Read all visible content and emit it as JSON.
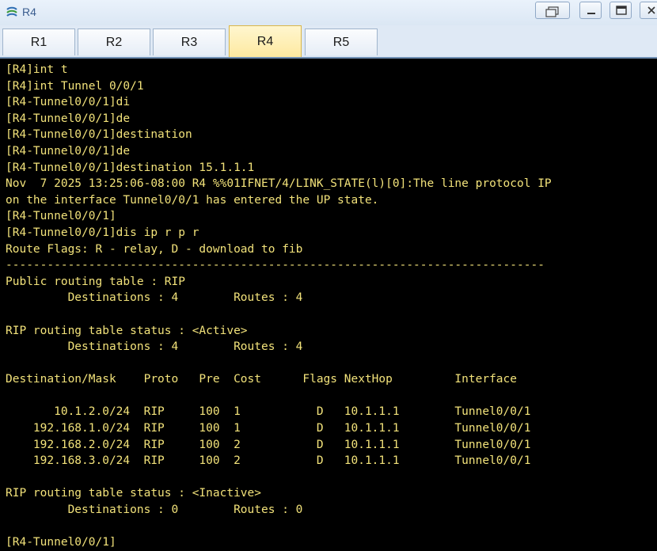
{
  "window": {
    "title": "R4"
  },
  "tabs": [
    {
      "label": "R1",
      "active": false
    },
    {
      "label": "R2",
      "active": false
    },
    {
      "label": "R3",
      "active": false
    },
    {
      "label": "R4",
      "active": true
    },
    {
      "label": "R5",
      "active": false
    }
  ],
  "colors": {
    "terminal_background": "#000000",
    "terminal_text": "#f2e27a",
    "active_tab": "#fde9a0",
    "title_text": "#3a5d8f"
  },
  "icons": {
    "app": "ensp-router-icon",
    "restore": "restore-icon",
    "minimize": "minimize-icon",
    "maximize": "maximize-icon",
    "close": "close-icon"
  },
  "terminal": {
    "lines": [
      "[R4]int t",
      "[R4]int Tunnel 0/0/1",
      "[R4-Tunnel0/0/1]di",
      "[R4-Tunnel0/0/1]de",
      "[R4-Tunnel0/0/1]destination",
      "[R4-Tunnel0/0/1]de",
      "[R4-Tunnel0/0/1]destination 15.1.1.1",
      "Nov  7 2025 13:25:06-08:00 R4 %%01IFNET/4/LINK_STATE(l)[0]:The line protocol IP",
      "on the interface Tunnel0/0/1 has entered the UP state.",
      "[R4-Tunnel0/0/1]",
      "[R4-Tunnel0/0/1]dis ip r p r",
      "Route Flags: R - relay, D - download to fib",
      "------------------------------------------------------------------------------",
      "Public routing table : RIP",
      "         Destinations : 4        Routes : 4",
      "",
      "RIP routing table status : <Active>",
      "         Destinations : 4        Routes : 4",
      "",
      "Destination/Mask    Proto   Pre  Cost      Flags NextHop         Interface",
      "",
      "       10.1.2.0/24  RIP     100  1           D   10.1.1.1        Tunnel0/0/1",
      "    192.168.1.0/24  RIP     100  1           D   10.1.1.1        Tunnel0/0/1",
      "    192.168.2.0/24  RIP     100  2           D   10.1.1.1        Tunnel0/0/1",
      "    192.168.3.0/24  RIP     100  2           D   10.1.1.1        Tunnel0/0/1",
      "",
      "RIP routing table status : <Inactive>",
      "         Destinations : 0        Routes : 0",
      "",
      "[R4-Tunnel0/0/1]"
    ]
  }
}
